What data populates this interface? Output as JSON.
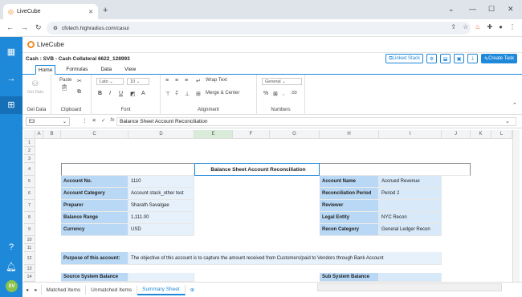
{
  "browser": {
    "tab_title": "LiveCube",
    "url": "cfotech.highradius.com/casui"
  },
  "app": {
    "logo_text": "LiveCube",
    "workbook_title": "Cash : SVB - Cash Collateral 6622_128993",
    "linked_stack_label": "Linked Stack",
    "create_task_label": "Create Task"
  },
  "sidebar": {
    "avatar_initials": "SV"
  },
  "menu": {
    "tabs": [
      "Home",
      "Formulas",
      "Data",
      "View"
    ],
    "active": "Home"
  },
  "ribbon": {
    "get_data_group": "Get Data",
    "get_data_button": "Get Data",
    "clipboard_group": "Clipboard",
    "paste_label": "Paste",
    "font_group": "Font",
    "font_name": "Lato",
    "font_size": "10",
    "alignment_group": "Alignment",
    "wrap_text": "Wrap Text",
    "merge_center": "Merge & Center",
    "numbers_group": "Numbers",
    "number_format": "General"
  },
  "formula_bar": {
    "cell_ref": "E3",
    "fx": "fx",
    "content": "Balance Sheet Account Reconciliation"
  },
  "columns": [
    "A",
    "B",
    "C",
    "D",
    "E",
    "F",
    "G",
    "H",
    "I",
    "J",
    "K",
    "L"
  ],
  "rows": [
    "1",
    "2",
    "3",
    "4",
    "5",
    "6",
    "7",
    "8",
    "9",
    "10",
    "11",
    "12",
    "13",
    "14",
    "15"
  ],
  "sheet": {
    "title": "Balance Sheet Account Reconciliation",
    "left_labels": [
      "Account No.",
      "Account Category",
      "Preparer",
      "Balance Range",
      "Currency"
    ],
    "left_values": [
      "1110",
      "Account stack_other test",
      "Sharath Savalgae",
      "1,111.00",
      "USD"
    ],
    "right_labels": [
      "Account Name",
      "Reconciliation Period",
      "Reviewer",
      "Legal Entity",
      "Recon Category"
    ],
    "right_values": [
      "Accrued Revenue",
      "Period 2",
      "",
      "NYC Recon",
      "General Ledger Recon"
    ],
    "purpose_label": "Purpose of this account:",
    "purpose_text": "The objective of this account is to capture the amount received from Customers/paid to Vendors through Bank Account",
    "source_balance_label": "Source System Balance",
    "sub_balance_label": "Sub System Balance"
  },
  "sheet_tabs": [
    "Matched Items",
    "Unmatched Items",
    "Summary Sheet"
  ],
  "active_sheet": "Summary Sheet"
}
